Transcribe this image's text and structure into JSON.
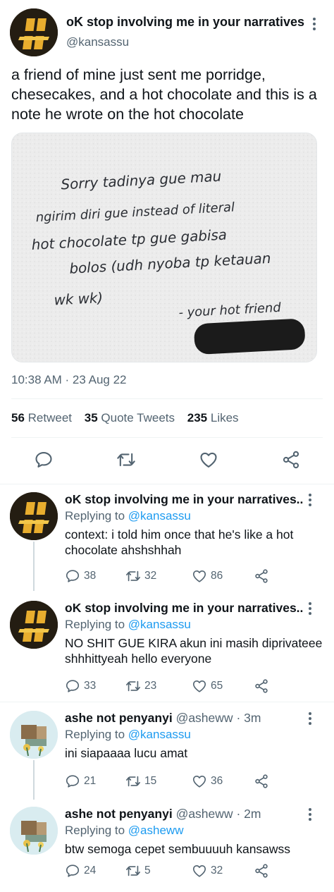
{
  "main_tweet": {
    "display_name": "oK stop involving me in your narratives",
    "handle": "@kansassu",
    "text": "a friend of mine just sent me porridge, chesecakes, and a hot chocolate and this is a note he wrote on the hot chocolate",
    "photo_note_lines": [
      "Sorry tadinya gue mau",
      "ngirim diri gue instead of literal",
      "hot chocolate tp gue gabisa",
      "bolos (udh nyoba tp ketauan",
      "wk wk)",
      "- your hot friend"
    ],
    "timestamp": "10:38 AM · 23 Aug 22",
    "stats": {
      "retweets_count": "56",
      "retweets_label": "Retweet",
      "quotes_count": "35",
      "quotes_label": "Quote Tweets",
      "likes_count": "235",
      "likes_label": "Likes"
    }
  },
  "replies": [
    {
      "display_name": "oK stop involving me in your narratives..",
      "handle": "",
      "time": "",
      "replying_label": "Replying to",
      "replying_to": "@kansassu",
      "text": "context: i told him once that he's like a hot chocolate ahshshhah",
      "replies": "38",
      "retweets": "32",
      "likes": "86"
    },
    {
      "display_name": "oK stop involving me in your narratives..",
      "handle": "",
      "time": "",
      "replying_label": "Replying to",
      "replying_to": "@kansassu",
      "text": "NO SHIT GUE KIRA akun ini masih diprivateee shhhittyeah hello everyone",
      "replies": "33",
      "retweets": "23",
      "likes": "65"
    },
    {
      "display_name": "ashe not penyanyi",
      "handle": "@asheww",
      "time": "· 3m",
      "replying_label": "Replying to",
      "replying_to": "@kansassu",
      "text": "ini siapaaaa lucu amat",
      "replies": "21",
      "retweets": "15",
      "likes": "36"
    },
    {
      "display_name": "ashe not penyanyi",
      "handle": "@asheww",
      "time": "· 2m",
      "replying_label": "Replying to",
      "replying_to": "@asheww",
      "text": "btw semoga cepet sembuuuuh kansawss",
      "replies": "24",
      "retweets": "5",
      "likes": "32"
    }
  ],
  "icons": [
    "more-icon",
    "reply-icon",
    "retweet-icon",
    "like-icon",
    "share-icon"
  ],
  "colors": {
    "text": "#0f1419",
    "secondary": "#536471",
    "link": "#1d9bf0",
    "divider": "#eff3f4"
  }
}
